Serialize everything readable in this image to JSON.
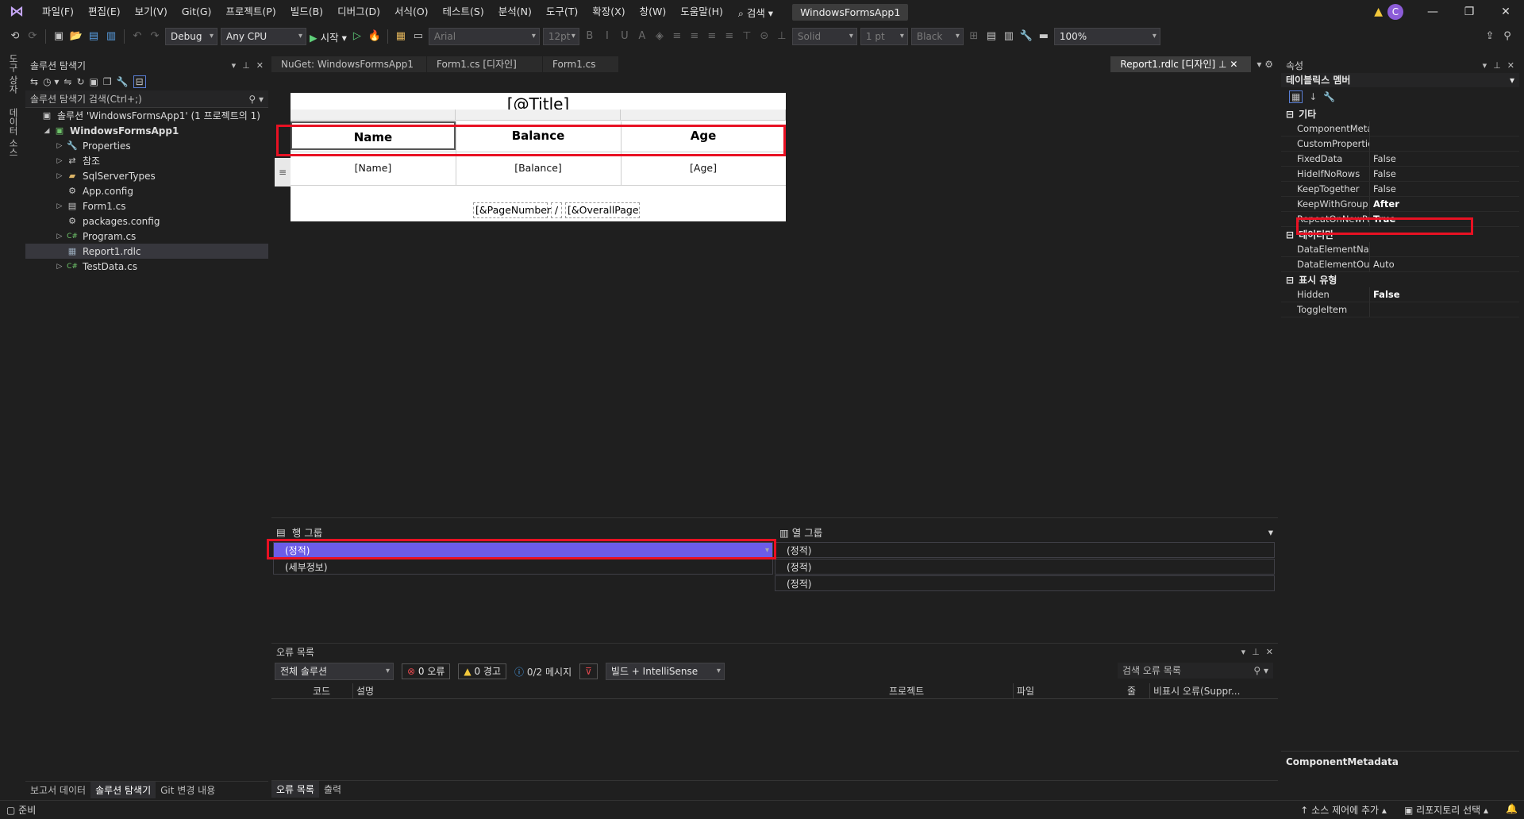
{
  "menu": {
    "items": [
      "파일(F)",
      "편집(E)",
      "보기(V)",
      "Git(G)",
      "프로젝트(P)",
      "빌드(B)",
      "디버그(D)",
      "서식(O)",
      "테스트(S)",
      "분석(N)",
      "도구(T)",
      "확장(X)",
      "창(W)",
      "도움말(H)"
    ],
    "search_label": "⌕ 검색 ▾",
    "solution_name": "WindowsFormsApp1",
    "user_initial": "C"
  },
  "toolbar": {
    "config": "Debug",
    "platform": "Any CPU",
    "start_label": "시작",
    "font": "Arial",
    "font_size": "12pt",
    "border_style": "Solid",
    "border_width": "1 pt",
    "border_color": "Black",
    "zoom": "100%"
  },
  "left_tabs": [
    "도구 상자",
    "데이터 소스"
  ],
  "solution_explorer": {
    "title": "솔루션 탐색기",
    "search_placeholder": "솔루션 탐색기 검색(Ctrl+;)",
    "items": [
      {
        "label": "솔루션 'WindowsFormsApp1' (1 프로젝트의 1)",
        "icon": "solution-icon",
        "level": 0,
        "arrow": ""
      },
      {
        "label": "WindowsFormsApp1",
        "icon": "project-icon",
        "level": 1,
        "arrow": "◢",
        "bold": true
      },
      {
        "label": "Properties",
        "icon": "wrench-icon",
        "level": 2,
        "arrow": "▷"
      },
      {
        "label": "참조",
        "icon": "references-icon",
        "level": 2,
        "arrow": "▷"
      },
      {
        "label": "SqlServerTypes",
        "icon": "folder-icon",
        "level": 2,
        "arrow": "▷"
      },
      {
        "label": "App.config",
        "icon": "config-file-icon",
        "level": 2,
        "arrow": ""
      },
      {
        "label": "Form1.cs",
        "icon": "form-file-icon",
        "level": 2,
        "arrow": "▷"
      },
      {
        "label": "packages.config",
        "icon": "config-file-icon",
        "level": 2,
        "arrow": ""
      },
      {
        "label": "Program.cs",
        "icon": "csharp-file-icon",
        "level": 2,
        "arrow": "▷"
      },
      {
        "label": "Report1.rdlc",
        "icon": "report-file-icon",
        "level": 2,
        "arrow": "",
        "selected": true
      },
      {
        "label": "TestData.cs",
        "icon": "csharp-file-icon",
        "level": 2,
        "arrow": "▷"
      }
    ],
    "bottom_tabs": [
      "보고서 데이터",
      "솔루션 탐색기",
      "Git 변경 내용"
    ]
  },
  "doc_tabs": [
    "NuGet: WindowsFormsApp1",
    "Form1.cs [디자인]",
    "Form1.cs",
    "Report1.rdlc [디자인]"
  ],
  "report": {
    "title": "[@Title]",
    "headers": [
      "Name",
      "Balance",
      "Age"
    ],
    "details": [
      "[Name]",
      "[Balance]",
      "[Age]"
    ],
    "page_number": "[&PageNumber]",
    "page_sep": "/",
    "overall_pages": "[&OverallPageN"
  },
  "groups": {
    "row_title": "행 그룹",
    "col_title": "열 그룹",
    "row_items": [
      "(정적)",
      "(세부정보)"
    ],
    "col_items": [
      "(정적)",
      "(정적)",
      "(정적)"
    ]
  },
  "errors": {
    "title": "오류 목록",
    "scope": "전체 솔루션",
    "errors_label": "0 오류",
    "warnings_label": "0 경고",
    "messages_label": "0/2 메시지",
    "build_filter": "빌드 + IntelliSense",
    "search_placeholder": "검색 오류 목록",
    "columns": [
      "코드",
      "설명",
      "프로젝트",
      "파일",
      "줄",
      "비표시 오류(Suppr..."
    ],
    "tabs": [
      "오류 목록",
      "출력"
    ]
  },
  "properties": {
    "title": "속성",
    "object_type": "테이블릭스 멤버",
    "categories": [
      {
        "name": "기타",
        "rows": [
          {
            "name": "ComponentMetadat",
            "value": ""
          },
          {
            "name": "CustomProperties",
            "value": ""
          },
          {
            "name": "FixedData",
            "value": "False"
          },
          {
            "name": "HideIfNoRows",
            "value": "False"
          },
          {
            "name": "KeepTogether",
            "value": "False"
          },
          {
            "name": "KeepWithGroup",
            "value": "After",
            "bold": true
          },
          {
            "name": "RepeatOnNewPage",
            "value": "True",
            "bold": true
          }
        ]
      },
      {
        "name": "데이터만",
        "rows": [
          {
            "name": "DataElementName",
            "value": ""
          },
          {
            "name": "DataElementOutput",
            "value": "Auto"
          }
        ]
      },
      {
        "name": "표시 유형",
        "rows": [
          {
            "name": "Hidden",
            "value": "False",
            "bold": true
          },
          {
            "name": "ToggleItem",
            "value": ""
          }
        ]
      }
    ],
    "description": "ComponentMetadata"
  },
  "status": {
    "left": "준비",
    "source_control": "소스 제어에 추가",
    "repo": "리포지토리 선택"
  },
  "colors": {
    "accent": "#6c5ce7",
    "highlight": "#e81123"
  }
}
